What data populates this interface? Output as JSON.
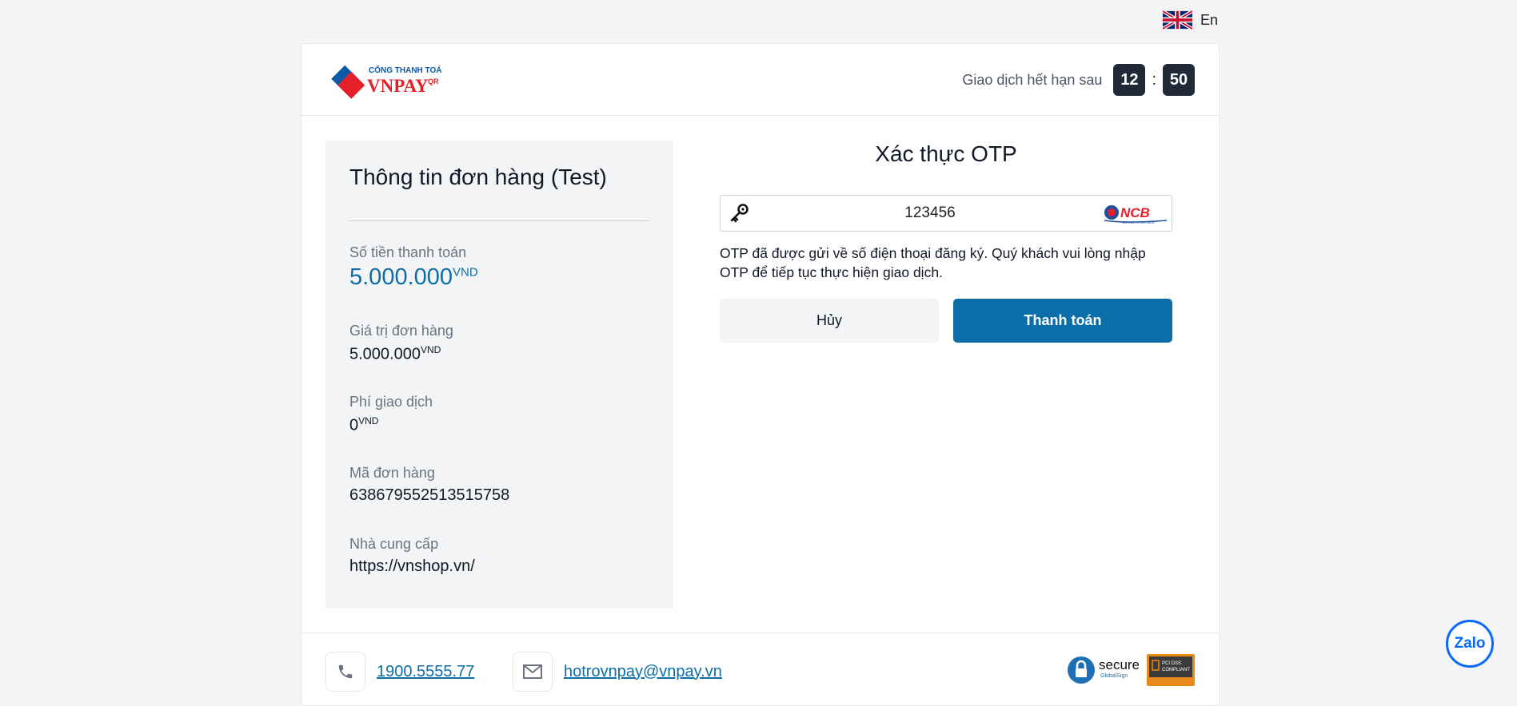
{
  "lang": {
    "label": "En"
  },
  "header": {
    "logo_small": "CỔNG THANH TOÁN",
    "logo_main": "VNPAY",
    "logo_qr": "QR",
    "expire_label": "Giao dịch hết hạn sau",
    "minutes": "12",
    "separator": ":",
    "seconds": "50"
  },
  "order": {
    "title": "Thông tin đơn hàng (Test)",
    "amount_label": "Số tiền thanh toán",
    "amount_value": "5.000.000",
    "amount_currency": "VND",
    "order_value_label": "Giá trị đơn hàng",
    "order_value": "5.000.000",
    "order_value_currency": "VND",
    "fee_label": "Phí giao dịch",
    "fee_value": "0",
    "fee_currency": "VND",
    "order_id_label": "Mã đơn hàng",
    "order_id_value": "638679552513515758",
    "provider_label": "Nhà cung cấp",
    "provider_value": "https://vnshop.vn/"
  },
  "otp": {
    "title": "Xác thực OTP",
    "value": "123456",
    "bank": "NCB",
    "bank_sub": "NATIONAL CITIZEN BANK",
    "note": "OTP đã được gửi về số điện thoại đăng ký. Quý khách vui lòng nhập OTP để tiếp tục thực hiện giao dịch."
  },
  "buttons": {
    "cancel": "Hủy",
    "pay": "Thanh toán"
  },
  "footer": {
    "phone": "1900.5555.77",
    "email": "hotrovnpay@vnpay.vn",
    "secure_label": "secure",
    "secure_sub": "GlobalSign",
    "pci_label": "PCI DSS",
    "pci_sub": "COMPLIANT"
  },
  "zalo": {
    "label": "Zalo"
  },
  "colors": {
    "primary": "#0b6ea8",
    "dark": "#1f2937",
    "panel": "#f3f4f6"
  }
}
